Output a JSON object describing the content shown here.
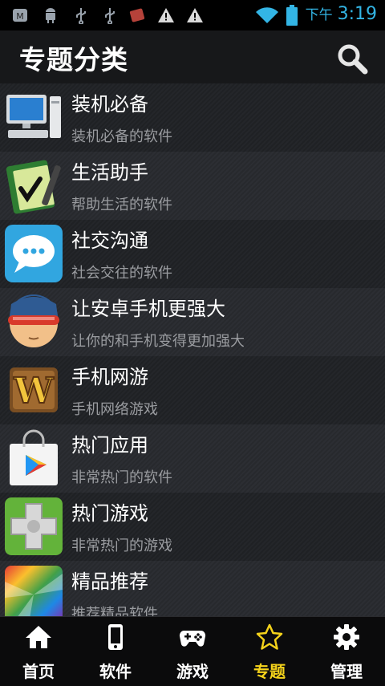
{
  "status_bar": {
    "ampm": "下午",
    "time": "3:19"
  },
  "header": {
    "title": "专题分类"
  },
  "categories": [
    {
      "title": "装机必备",
      "subtitle": "装机必备的软件",
      "icon": "computer-icon"
    },
    {
      "title": "生活助手",
      "subtitle": "帮助生活的软件",
      "icon": "tasks-notebook-icon"
    },
    {
      "title": "社交沟通",
      "subtitle": "社会交往的软件",
      "icon": "chat-bubble-icon"
    },
    {
      "title": "让安卓手机更强大",
      "subtitle": "让你的和手机变得更加强大",
      "icon": "cyclops-avatar-icon"
    },
    {
      "title": "手机网游",
      "subtitle": "手机网络游戏",
      "icon": "wow-game-icon"
    },
    {
      "title": "热门应用",
      "subtitle": "非常热门的软件",
      "icon": "play-store-bag-icon"
    },
    {
      "title": "热门游戏",
      "subtitle": "非常热门的游戏",
      "icon": "gamepad-cross-icon"
    },
    {
      "title": "精品推荐",
      "subtitle": "推荐精品软件",
      "icon": "rainbow-swirl-icon"
    }
  ],
  "nav": [
    {
      "label": "首页",
      "icon": "home-icon"
    },
    {
      "label": "软件",
      "icon": "phone-icon"
    },
    {
      "label": "游戏",
      "icon": "gamepad-icon"
    },
    {
      "label": "专题",
      "icon": "star-icon",
      "active": true
    },
    {
      "label": "管理",
      "icon": "gear-icon"
    }
  ],
  "colors": {
    "accent_blue": "#33b5e5",
    "active_nav": "#f5d31b"
  }
}
